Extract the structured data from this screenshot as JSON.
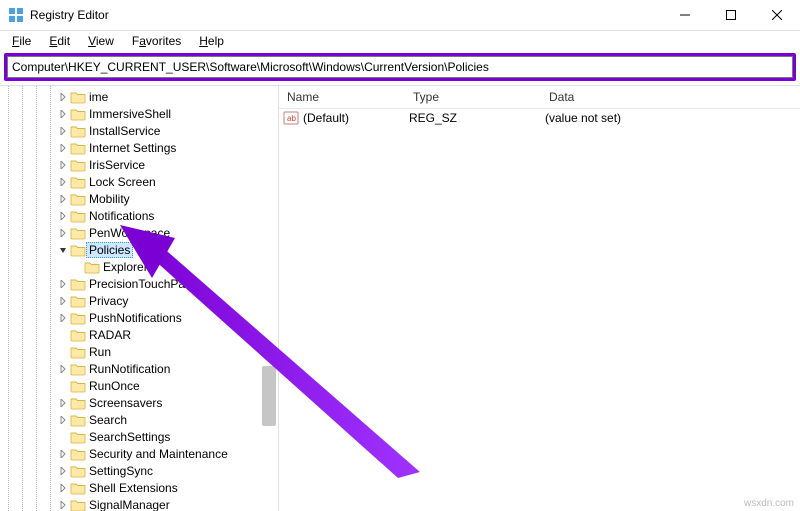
{
  "window": {
    "title": "Registry Editor"
  },
  "menu": {
    "file": "File",
    "edit": "Edit",
    "view": "View",
    "favorites": "Favorites",
    "help": "Help"
  },
  "address": {
    "path": "Computer\\HKEY_CURRENT_USER\\Software\\Microsoft\\Windows\\CurrentVersion\\Policies"
  },
  "tree": {
    "items": [
      {
        "label": "ime",
        "depth": 4,
        "twisty": "closed"
      },
      {
        "label": "ImmersiveShell",
        "depth": 4,
        "twisty": "closed"
      },
      {
        "label": "InstallService",
        "depth": 4,
        "twisty": "closed"
      },
      {
        "label": "Internet Settings",
        "depth": 4,
        "twisty": "closed"
      },
      {
        "label": "IrisService",
        "depth": 4,
        "twisty": "closed"
      },
      {
        "label": "Lock Screen",
        "depth": 4,
        "twisty": "closed"
      },
      {
        "label": "Mobility",
        "depth": 4,
        "twisty": "closed"
      },
      {
        "label": "Notifications",
        "depth": 4,
        "twisty": "closed"
      },
      {
        "label": "PenWorkspace",
        "depth": 4,
        "twisty": "closed"
      },
      {
        "label": "Policies",
        "depth": 4,
        "twisty": "open",
        "selected": true
      },
      {
        "label": "Explorer",
        "depth": 5,
        "twisty": "none"
      },
      {
        "label": "PrecisionTouchPad",
        "depth": 4,
        "twisty": "closed"
      },
      {
        "label": "Privacy",
        "depth": 4,
        "twisty": "closed"
      },
      {
        "label": "PushNotifications",
        "depth": 4,
        "twisty": "closed"
      },
      {
        "label": "RADAR",
        "depth": 4,
        "twisty": "none"
      },
      {
        "label": "Run",
        "depth": 4,
        "twisty": "none"
      },
      {
        "label": "RunNotification",
        "depth": 4,
        "twisty": "closed"
      },
      {
        "label": "RunOnce",
        "depth": 4,
        "twisty": "none"
      },
      {
        "label": "Screensavers",
        "depth": 4,
        "twisty": "closed"
      },
      {
        "label": "Search",
        "depth": 4,
        "twisty": "closed"
      },
      {
        "label": "SearchSettings",
        "depth": 4,
        "twisty": "none"
      },
      {
        "label": "Security and Maintenance",
        "depth": 4,
        "twisty": "closed"
      },
      {
        "label": "SettingSync",
        "depth": 4,
        "twisty": "closed"
      },
      {
        "label": "Shell Extensions",
        "depth": 4,
        "twisty": "closed"
      },
      {
        "label": "SignalManager",
        "depth": 4,
        "twisty": "closed"
      }
    ]
  },
  "list": {
    "headers": {
      "name": "Name",
      "type": "Type",
      "data": "Data"
    },
    "rows": [
      {
        "name": "(Default)",
        "type": "REG_SZ",
        "data": "(value not set)"
      }
    ]
  },
  "watermark": "wsxdn.com"
}
